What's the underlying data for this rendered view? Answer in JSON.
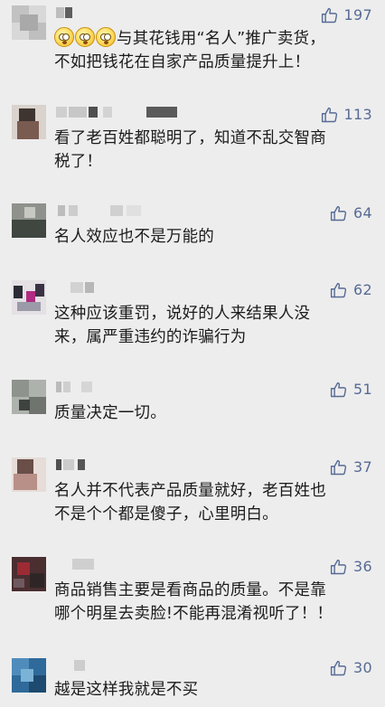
{
  "comments": [
    {
      "likes": "197",
      "lines": [
        "与其花钱用“名人”推广卖货，",
        "不如把钱花在自家产品质量提升上！"
      ],
      "emoji_count": 3
    },
    {
      "likes": "113",
      "lines": [
        "看了老百姓都聪明了，知道不乱交智商",
        "税了！"
      ]
    },
    {
      "likes": "64",
      "lines": [
        "名人效应也不是万能的"
      ]
    },
    {
      "likes": "62",
      "lines": [
        "这种应该重罚，说好的人来结果人没",
        "来，属严重违约的诈骗行为"
      ]
    },
    {
      "likes": "51",
      "lines": [
        "质量决定一切。"
      ]
    },
    {
      "likes": "37",
      "lines": [
        "名人并不代表产品质量就好，老百姓也",
        "不是个个都是傻子，心里明白。"
      ]
    },
    {
      "likes": "36",
      "lines": [
        "商品销售主要是看商品的质量。不是靠",
        "哪个明星去卖脸!不能再混淆视听了！！"
      ]
    },
    {
      "likes": "30",
      "lines": [
        "越是这样我就是不买"
      ]
    }
  ],
  "icons": {
    "like": "thumbs-up-icon",
    "emoji": "flushed-face-emoji-icon"
  },
  "colors": {
    "background": "#ededed",
    "like": "#576b95",
    "text": "#1b1b1b"
  }
}
